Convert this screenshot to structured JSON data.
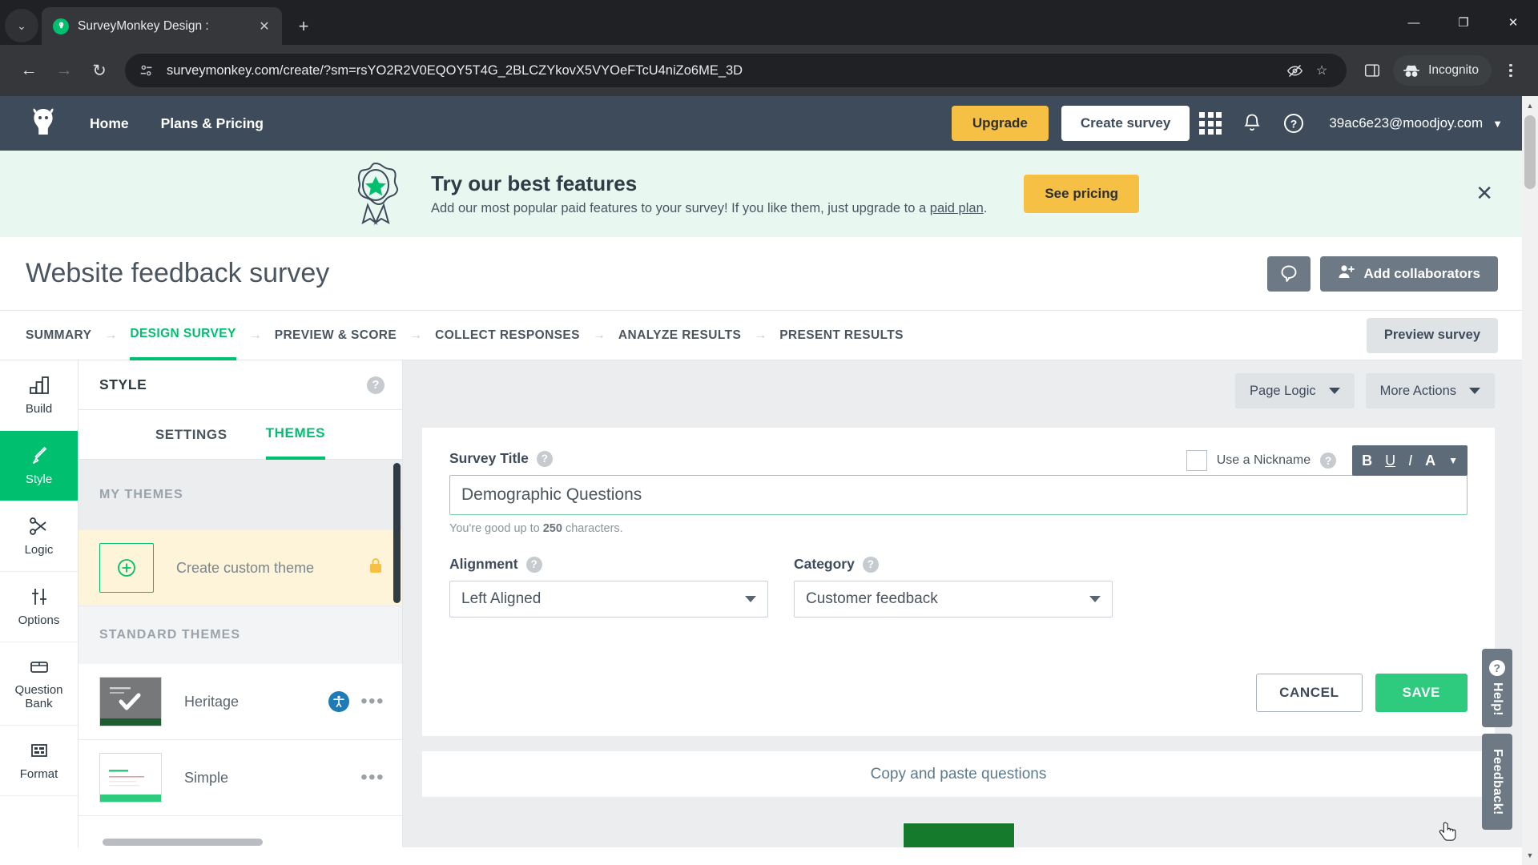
{
  "browser": {
    "tab": {
      "title": "SurveyMonkey Design :",
      "favicon": "surveymonkey-icon",
      "close": "✕"
    },
    "new_tab_label": "+",
    "tab_list_caret": "⌄",
    "window": {
      "minimize": "—",
      "maximize": "❐",
      "close": "✕"
    },
    "nav": {
      "back": "←",
      "forward": "→",
      "reload": "↻"
    },
    "url": "surveymonkey.com/create/?sm=rsYO2R2V0EQOY5T4G_2BLCZYkovX5VYOeFTcU4niZo6ME_3D",
    "omni_icons": {
      "site_info": "page-info-icon",
      "eye_off": "◎",
      "bookmark": "☆"
    },
    "right": {
      "side_panel": "side-panel-icon",
      "incognito_label": "Incognito",
      "menu": "kebab-menu"
    }
  },
  "sm_nav": {
    "logo": "surveymonkey-logo",
    "links": [
      "Home",
      "Plans & Pricing"
    ],
    "upgrade": "Upgrade",
    "create_survey": "Create survey",
    "apps_icon": "apps-grid-icon",
    "bell_icon": "notifications-bell-icon",
    "help_icon": "help-question-icon",
    "account_email": "39ac6e23@moodjoy.com",
    "account_caret": "▼"
  },
  "promo": {
    "badge_icon": "award-ribbon-icon",
    "heading": "Try our best features",
    "body_before": "Add our most popular paid features to your survey! If you like them, just upgrade to a ",
    "body_link": "paid plan",
    "body_after": ".",
    "cta": "See pricing",
    "close": "✕"
  },
  "survey_header": {
    "title": "Website feedback survey",
    "comment_icon": "comment-balloon-icon",
    "collaborators_icon": "add-person-icon",
    "collaborators_label": "Add collaborators"
  },
  "stage_tabs": {
    "items": [
      {
        "label": "SUMMARY",
        "active": false
      },
      {
        "label": "DESIGN SURVEY",
        "active": true
      },
      {
        "label": "PREVIEW & SCORE",
        "active": false
      },
      {
        "label": "COLLECT RESPONSES",
        "active": false
      },
      {
        "label": "ANALYZE RESULTS",
        "active": false
      },
      {
        "label": "PRESENT RESULTS",
        "active": false
      }
    ],
    "separator": "→",
    "preview_button": "Preview survey"
  },
  "rail": {
    "items": [
      {
        "label": "Build",
        "icon": "build-blocks-icon",
        "active": false
      },
      {
        "label": "Style",
        "icon": "paintbrush-icon",
        "active": true
      },
      {
        "label": "Logic",
        "icon": "logic-branch-icon",
        "active": false
      },
      {
        "label": "Options",
        "icon": "sliders-icon",
        "active": false
      },
      {
        "label": "Question Bank",
        "icon": "question-bank-icon",
        "active": false
      },
      {
        "label": "Format",
        "icon": "format-grid-icon",
        "active": false
      }
    ]
  },
  "style_panel": {
    "header": "STYLE",
    "header_help": "?",
    "tabs": [
      {
        "label": "SETTINGS",
        "active": false
      },
      {
        "label": "THEMES",
        "active": true
      }
    ],
    "sections": [
      {
        "heading": "MY THEMES",
        "rows": [
          {
            "name": "Create custom theme",
            "thumb": "plus-square-thumb",
            "lock": "🔒",
            "highlight": true,
            "dots": ""
          }
        ]
      },
      {
        "heading": "STANDARD THEMES",
        "rows": [
          {
            "name": "Heritage",
            "thumb": "heritage-thumb",
            "selected": true,
            "a11y": "♿",
            "dots": "•••",
            "highlight": false
          },
          {
            "name": "Simple",
            "thumb": "simple-thumb",
            "selected": false,
            "dots": "•••",
            "highlight": false
          }
        ]
      }
    ]
  },
  "canvas": {
    "page_logic": "Page Logic",
    "more_actions": "More Actions",
    "caret": "▼",
    "survey_title_label": "Survey Title",
    "survey_title_value": "Demographic Questions",
    "survey_title_placeholder": "Enter survey title",
    "hint_before": "You're good up to ",
    "hint_number": "250",
    "hint_after": " characters.",
    "nickname_label": "Use a Nickname",
    "nickname_checked": false,
    "format_buttons": [
      "B",
      "U",
      "I",
      "A",
      "▼"
    ],
    "alignment_label": "Alignment",
    "alignment_value": "Left Aligned",
    "category_label": "Category",
    "category_value": "Customer feedback",
    "cancel": "CANCEL",
    "save": "SAVE",
    "copy_paste": "Copy and paste questions"
  },
  "side_tabs": {
    "help": "Help!",
    "feedback": "Feedback!"
  },
  "colors": {
    "brand_green": "#00bf6f",
    "nav_slate": "#3e4b5b",
    "upgrade_yellow": "#f5c043",
    "promo_bg": "#e8f8f1",
    "save_green": "#2ecb7f"
  }
}
